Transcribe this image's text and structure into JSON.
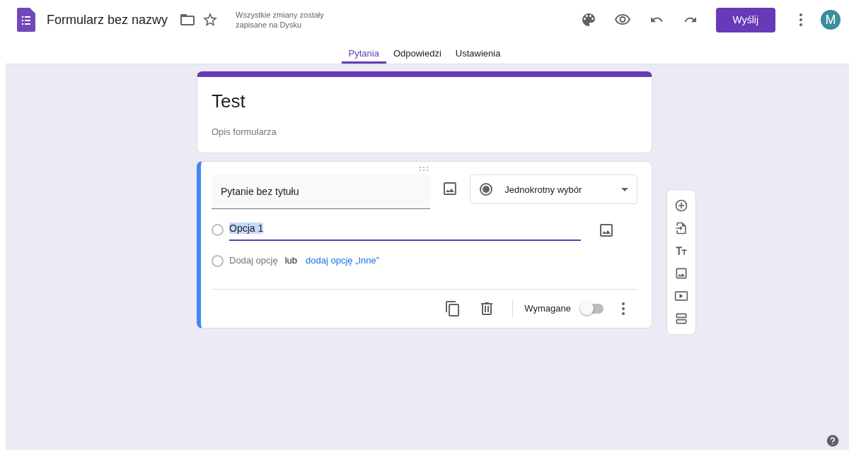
{
  "app": {
    "title": "Formularz bez nazwy",
    "save_status": "Wszystkie zmiany zostały zapisane na Dysku",
    "send_button": "Wyślij",
    "avatar": "M"
  },
  "tabs": [
    {
      "label": "Pytania",
      "selected": true
    },
    {
      "label": "Odpowiedzi",
      "selected": false
    },
    {
      "label": "Ustawienia",
      "selected": false
    }
  ],
  "form": {
    "title": "Test",
    "description": "Opis formularza"
  },
  "question": {
    "title": "Pytanie bez tytułu",
    "type": "Jednokrotny wybór",
    "options": [
      {
        "label": "Opcja 1",
        "highlighted": true
      }
    ],
    "add_option": "Dodaj opcję",
    "or": "lub",
    "add_other": "dodaj opcję „Inne”",
    "required_label": "Wymagane",
    "required": false
  }
}
